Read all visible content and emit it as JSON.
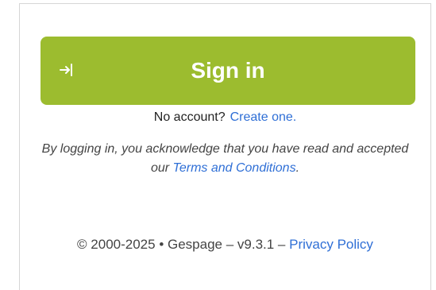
{
  "signin": {
    "label": "Sign in",
    "icon": "sign-in-arrow-icon",
    "color": "#9cbc2f"
  },
  "account": {
    "prompt": "No account?",
    "create_link": "Create one."
  },
  "terms": {
    "text_before": "By logging in, you acknowledge that you have read and accepted our",
    "link": "Terms and Conditions",
    "text_after": "."
  },
  "footer": {
    "copyright": "© 2000-2025 • Gespage – v9.3.1 –",
    "privacy_link": "Privacy Policy"
  },
  "colors": {
    "link": "#2f6fd6"
  }
}
